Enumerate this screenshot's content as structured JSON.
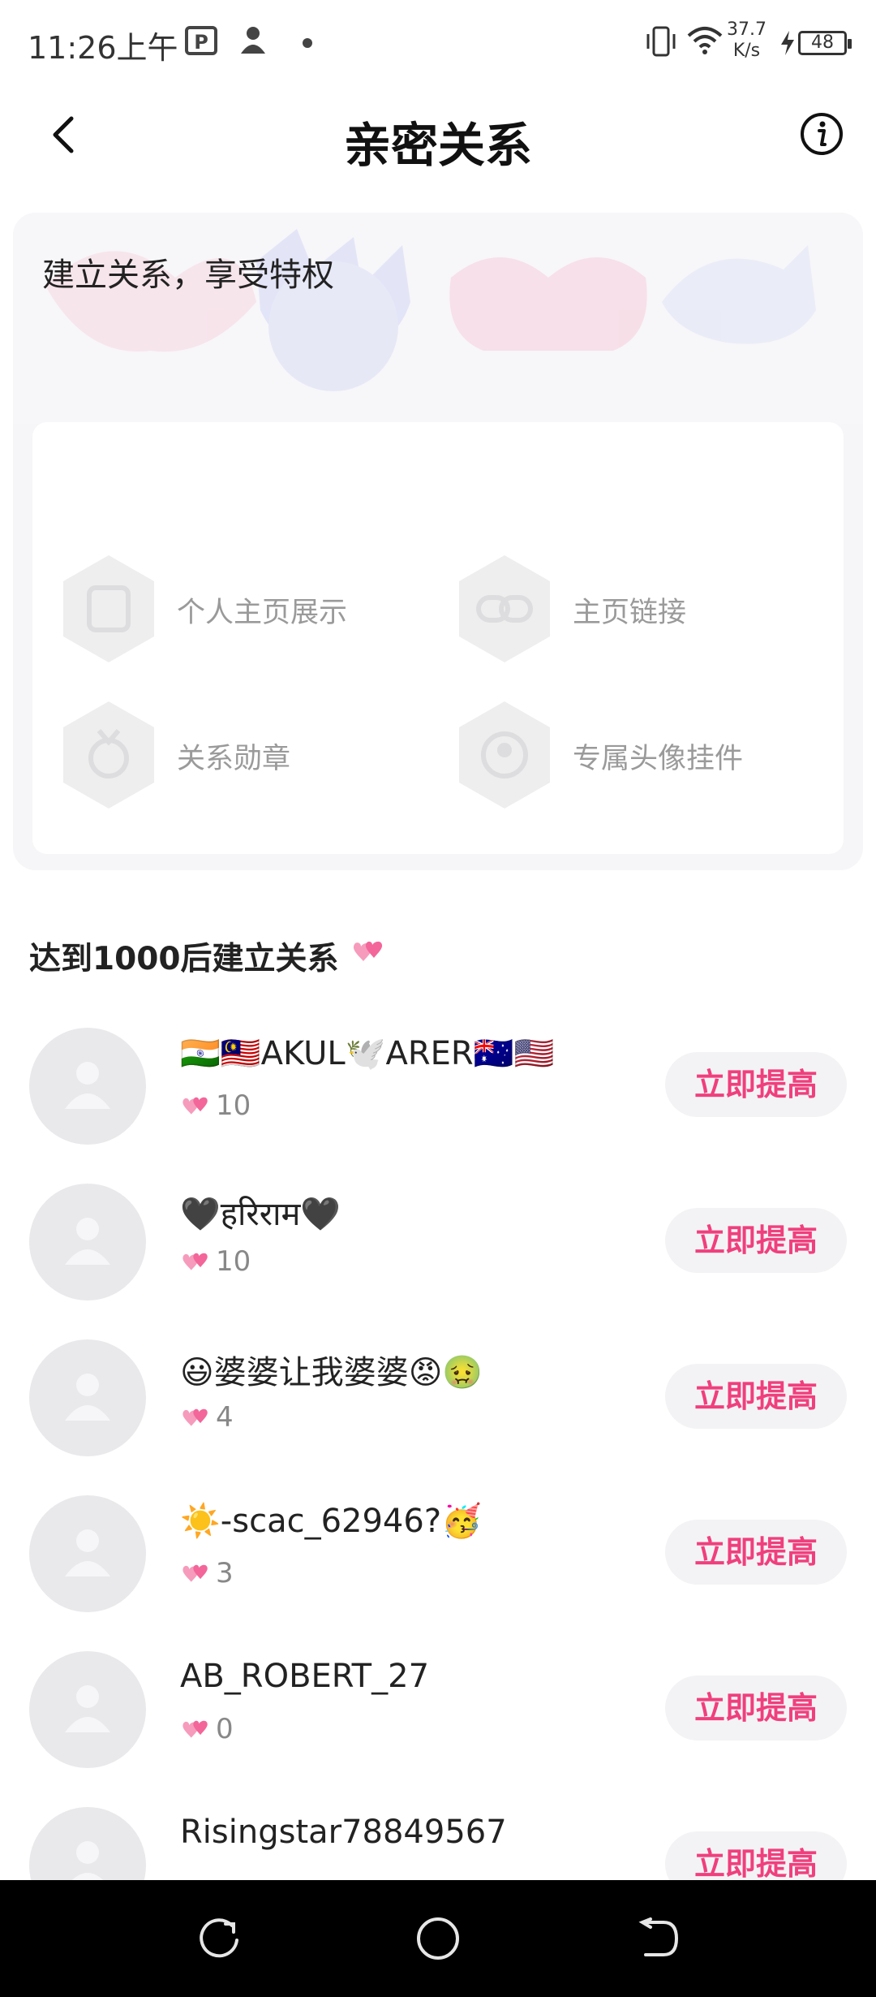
{
  "status_bar": {
    "time": "11:26上午",
    "net_speed_value": "37.7",
    "net_speed_unit": "K/s",
    "battery": "48",
    "icons": [
      "p-app-icon",
      "person-icon",
      "dot-icon",
      "vibrate-icon",
      "wifi-icon",
      "charging-icon",
      "battery-icon"
    ]
  },
  "header": {
    "title": "亲密关系",
    "back_icon": "chevron-left-icon",
    "info_icon": "info-icon"
  },
  "privileges": {
    "title": "建立关系，享受特权",
    "items": [
      {
        "label": "个人主页展示",
        "icon": "profile-display-icon"
      },
      {
        "label": "主页链接",
        "icon": "link-icon"
      },
      {
        "label": "关系勋章",
        "icon": "medal-icon"
      },
      {
        "label": "专属头像挂件",
        "icon": "avatar-frame-icon"
      }
    ]
  },
  "section": {
    "title": "达到1000后建立关系",
    "icon": "hearts-icon"
  },
  "users": [
    {
      "name": "🇮🇳🇲🇾AKUL🕊️ARER🇦🇺🇺🇸",
      "score": "10",
      "button": "立即提高"
    },
    {
      "name": "🖤हरिराम🖤",
      "score": "10",
      "button": "立即提高"
    },
    {
      "name": "😃婆婆让我婆婆😡🤢",
      "score": "4",
      "button": "立即提高"
    },
    {
      "name": "☀️-scac_62946?🥳",
      "score": "3",
      "button": "立即提高"
    },
    {
      "name": "AB_ROBERT_27",
      "score": "0",
      "button": "立即提高"
    },
    {
      "name": "Risingstar78849567",
      "score": "",
      "button": "立即提高"
    }
  ],
  "colors": {
    "accent": "#f03f7d",
    "button_bg": "#f3f3f5",
    "card_bg": "#f6f6f8",
    "nav_bg": "#000000"
  },
  "nav_bar": {
    "icons": [
      "recent-apps-icon",
      "home-icon",
      "back-nav-icon"
    ]
  }
}
